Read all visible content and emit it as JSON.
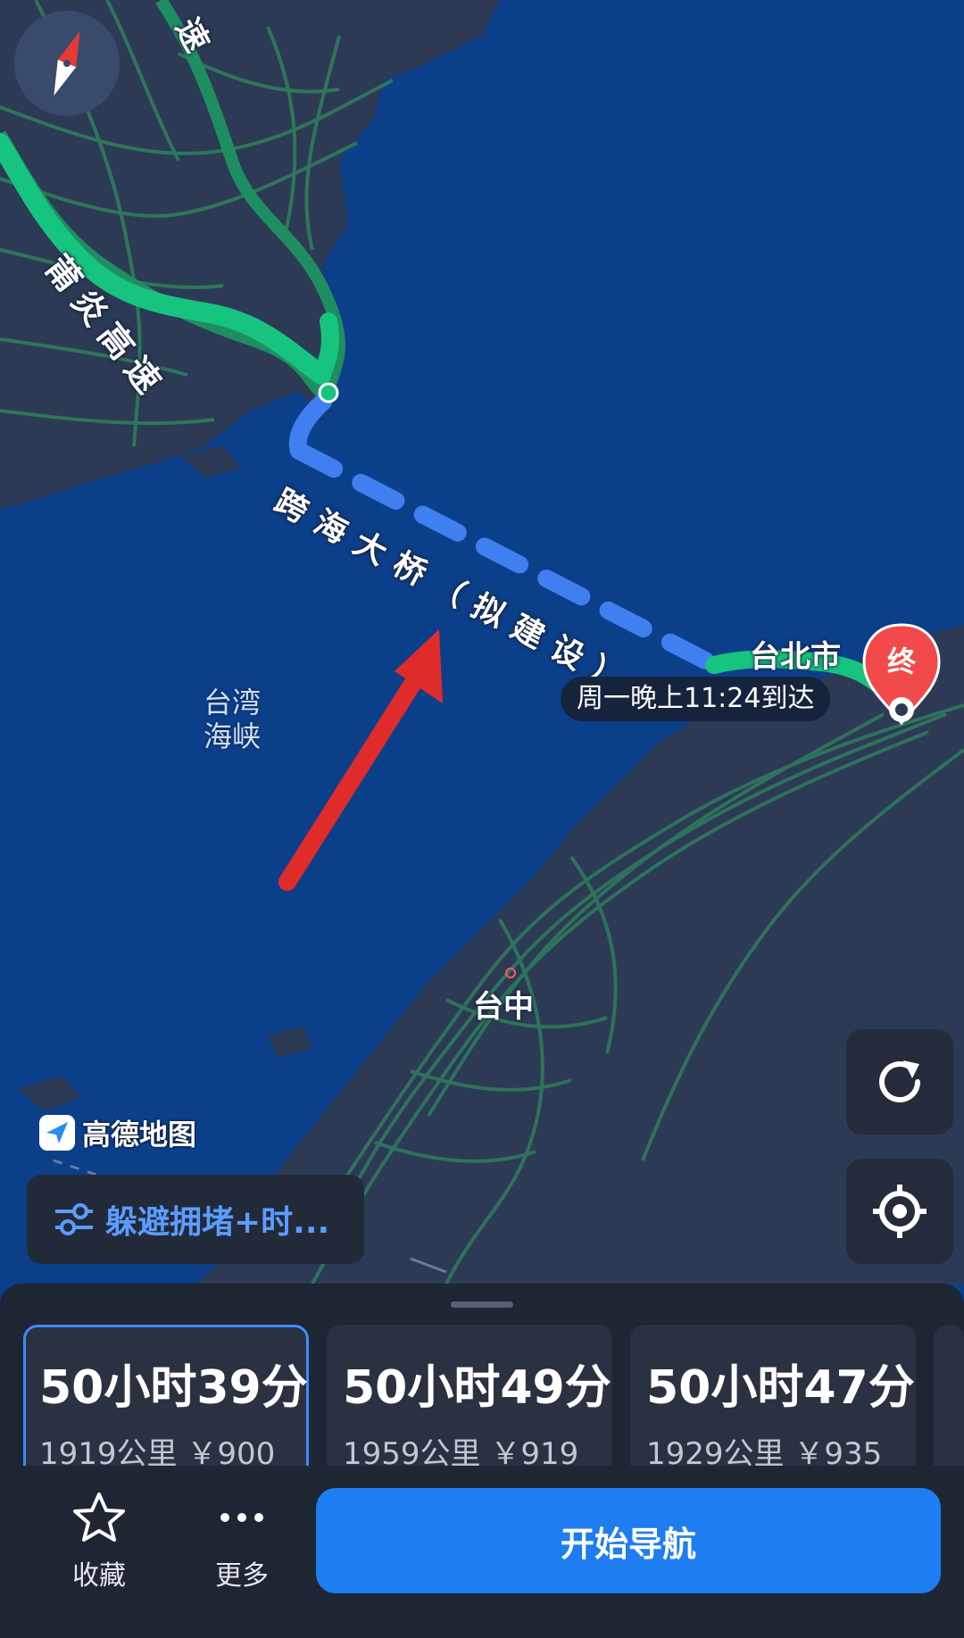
{
  "colors": {
    "sea": "#0c3f8a",
    "land": "#2c3a55",
    "road_green": "#2e7d5b",
    "route_green": "#16c47f",
    "proposed_route_blue": "#3f7ff0",
    "annotation_arrow": "#e02b2b",
    "destination_pin": "#f24a4a",
    "accent_blue": "#1e7df0"
  },
  "map": {
    "road_labels": [
      "莆炎高速",
      "跨海大桥（拟建设）"
    ],
    "partial_road_label": "速",
    "water_label": "台湾\n海峡",
    "cities": {
      "taipei": "台北市",
      "taichung": "台中"
    },
    "destination_marker": "终",
    "arrival_time": "周一晚上11:24到达",
    "attribution": "高德地图",
    "annotation": "red-arrow"
  },
  "controls": {
    "compass_icon": "compass-icon",
    "refresh_icon": "refresh-icon",
    "locate_icon": "locate-icon",
    "preference_icon": "sliders-icon",
    "preference_label": "躲避拥堵+时..."
  },
  "routes": [
    {
      "duration": "50小时39分",
      "meta": "1919公里 ￥900",
      "selected": true
    },
    {
      "duration": "50小时49分",
      "meta": "1959公里 ￥919",
      "selected": false
    },
    {
      "duration": "50小时47分",
      "meta": "1929公里 ￥935",
      "selected": false
    }
  ],
  "actions": {
    "favorite_icon": "star-icon",
    "favorite_label": "收藏",
    "more_icon": "more-icon",
    "more_label": "更多",
    "start_navigation": "开始导航"
  }
}
